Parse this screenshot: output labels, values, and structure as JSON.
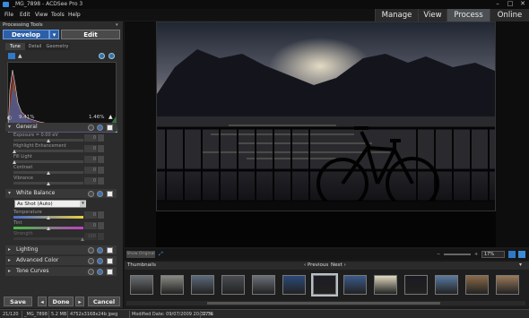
{
  "window": {
    "title": "_MG_7898 - ACDSee Pro 3",
    "controls": {
      "minimize": "–",
      "maximize": "□",
      "close": "✕"
    }
  },
  "menu": {
    "items": [
      "File",
      "Edit",
      "View",
      "Tools",
      "Help"
    ]
  },
  "modes": {
    "tabs": [
      {
        "label": "Manage",
        "active": false
      },
      {
        "label": "View",
        "active": false
      },
      {
        "label": "Process",
        "active": true
      },
      {
        "label": "Online",
        "active": false
      }
    ]
  },
  "panel": {
    "title": "Processing Tools",
    "develop_label": "Develop",
    "edit_label": "Edit",
    "subtabs": [
      "Tune",
      "Detail",
      "Geometry"
    ],
    "clip_left": "9.41%",
    "clip_right": "1.46%",
    "general": {
      "label": "General",
      "sliders": [
        {
          "label": "Exposure = 0.00 eV",
          "value": "0"
        },
        {
          "label": "Highlight Enhancement",
          "value": "0"
        },
        {
          "label": "Fill Light",
          "value": "0"
        },
        {
          "label": "Contrast",
          "value": "0"
        },
        {
          "label": "Vibrance",
          "value": "0"
        }
      ]
    },
    "white_balance": {
      "label": "White Balance",
      "preset": "As Shot (Auto)",
      "sliders": [
        {
          "label": "Temperature",
          "value": "0"
        },
        {
          "label": "Tint",
          "value": "0"
        },
        {
          "label": "Strength",
          "value": "100"
        }
      ]
    },
    "collapsed_sections": [
      "Lighting",
      "Advanced Color",
      "Tone Curves"
    ],
    "buttons": {
      "save": "Save",
      "done": "Done",
      "cancel": "Cancel",
      "prev": "◂",
      "next": "▸"
    }
  },
  "viewer": {
    "show_original": "Show Original",
    "zoom": "17%"
  },
  "thumbnails": {
    "label": "Thumbnails",
    "previous": "Previous",
    "next": "Next",
    "count": 13,
    "selected_index": 6
  },
  "status": {
    "position": "21/120",
    "filename": "_MG_7898",
    "size": "5.2 MB",
    "dims": "4752x3168x24b jpeg",
    "modified": "Modified Date: 09/07/2009 20:32:36",
    "zoom": "17%"
  }
}
